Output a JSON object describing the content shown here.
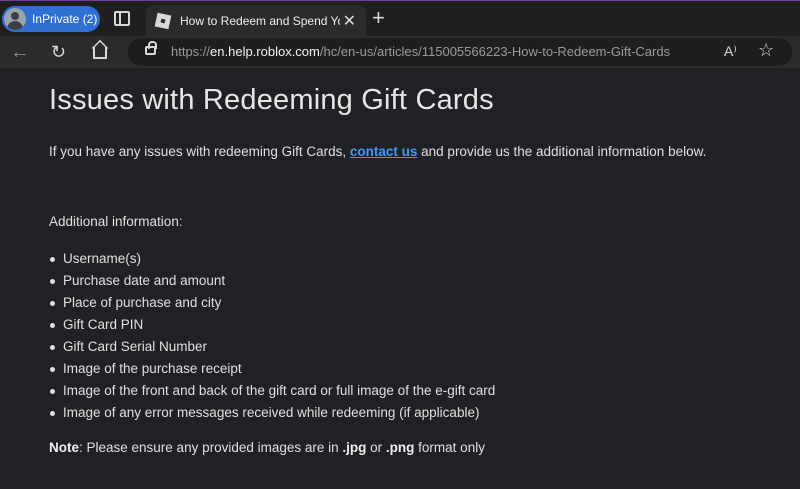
{
  "browser": {
    "profile_label": "InPrivate (2)",
    "tab_title": "How to Redeem and Spend Your",
    "tab_close_glyph": "✕",
    "new_tab_glyph": "+",
    "url_domain": "en.help.roblox.com",
    "url_prefix": "https://",
    "url_path": "/hc/en-us/articles/115005566223-How-to-Redeem-Gift-Cards",
    "read_aloud_glyph": "A⁾",
    "favorite_glyph": "☆",
    "back_glyph": "←",
    "reload_glyph": "↻",
    "icons": [
      "profile-icon",
      "tab-actions-icon",
      "roblox-favicon",
      "close-icon",
      "plus-icon",
      "back-icon",
      "reload-icon",
      "home-icon",
      "lock-icon",
      "read-aloud-icon",
      "star-icon"
    ]
  },
  "article": {
    "title": "Issues with Redeeming Gift Cards",
    "intro_before": "If you have any issues with redeeming Gift Cards, ",
    "intro_link": "contact us",
    "intro_after": " and provide us the additional information below.",
    "additional_label": "Additional information:",
    "items": [
      "Username(s)",
      "Purchase date and amount",
      "Place of purchase and city",
      "Gift Card PIN",
      "Gift Card Serial Number",
      "Image of the purchase receipt",
      "Image of the front and back of the gift card or full image of the e-gift card",
      "Image of any error messages received while redeeming (if applicable)"
    ],
    "note_label": "Note",
    "note_text_1": ": Please ensure any provided images are in ",
    "note_fmt1": ".jpg",
    "note_or": " or ",
    "note_fmt2": ".png",
    "note_text_2": " format only"
  },
  "colors": {
    "accent_profile": "#2f6fd1",
    "link": "#3a9bff",
    "page_background": "#202124"
  }
}
